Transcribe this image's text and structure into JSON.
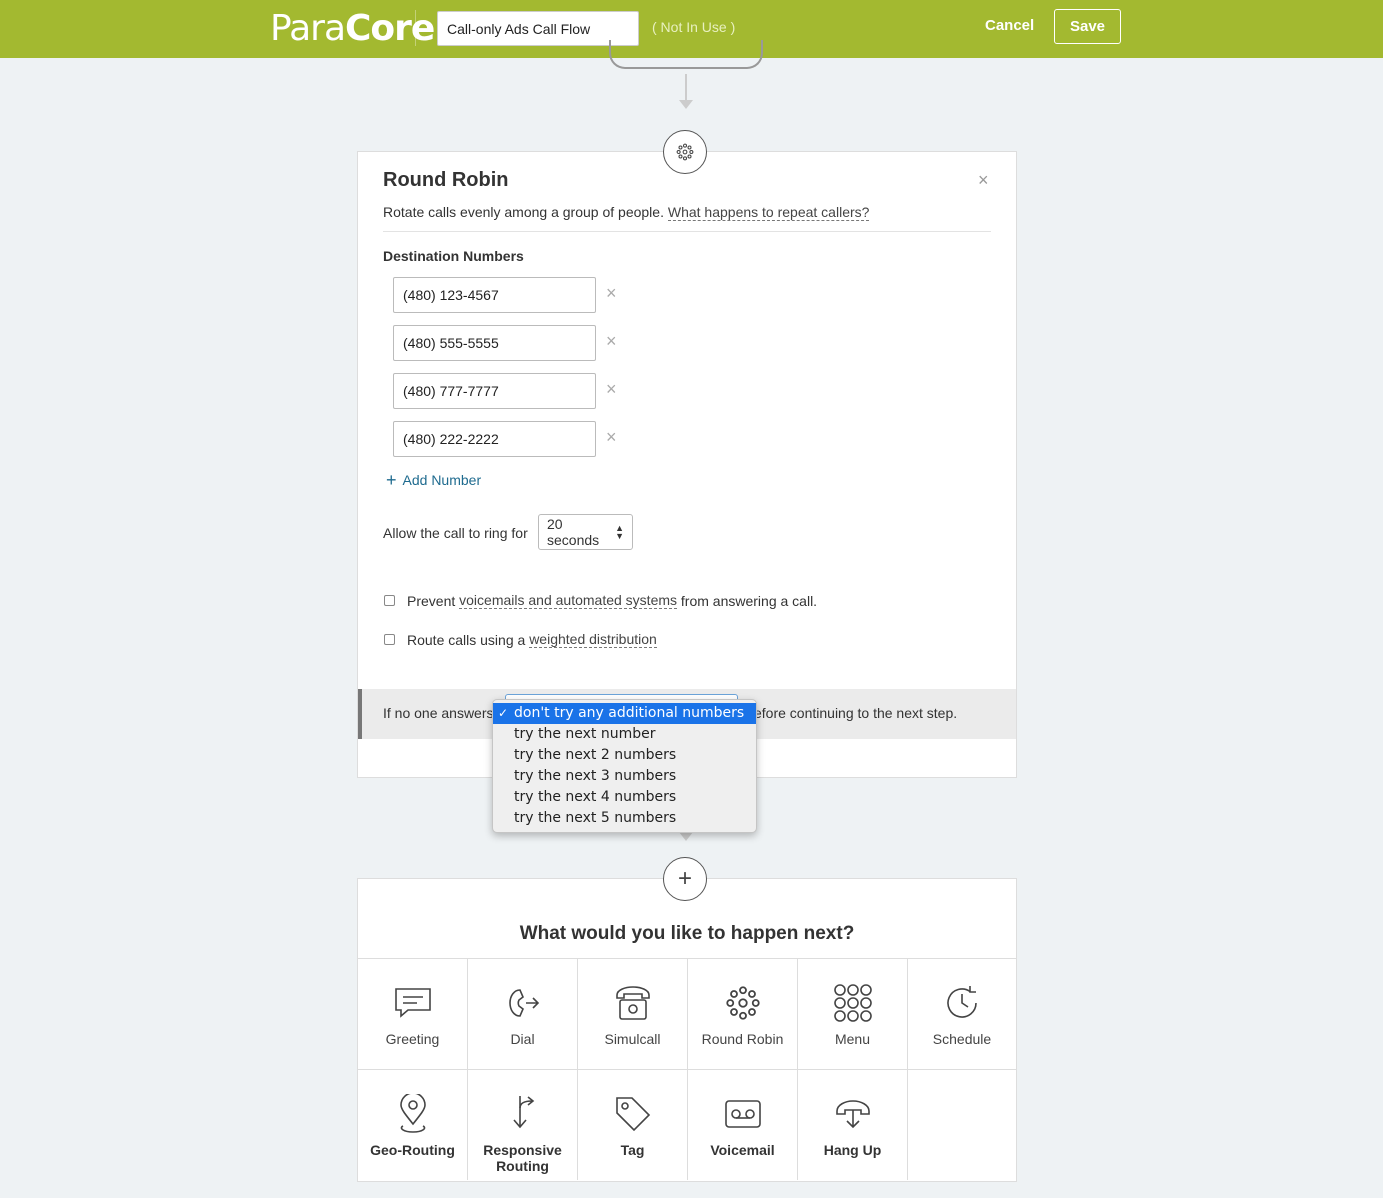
{
  "header": {
    "logo_light": "Para",
    "logo_bold": "Core",
    "flow_name": "Call-only Ads Call Flow",
    "status": "( Not In Use )",
    "cancel_label": "Cancel",
    "save_label": "Save",
    "brand_color": "#a3b930"
  },
  "round_robin": {
    "title": "Round Robin",
    "close_glyph": "×",
    "description": "Rotate calls evenly among a group of people.",
    "description_link": "What happens to repeat callers?",
    "destination_label": "Destination Numbers",
    "numbers": [
      {
        "value": "(480) 123-4567",
        "remove_glyph": "×"
      },
      {
        "value": "(480) 555-5555",
        "remove_glyph": "×"
      },
      {
        "value": "(480) 777-7777",
        "remove_glyph": "×"
      },
      {
        "value": "(480) 222-2222",
        "remove_glyph": "×"
      }
    ],
    "add_number_label": "Add Number",
    "add_glyph": "+",
    "ring_label": "Allow the call to ring for",
    "ring_value": "20 seconds",
    "prevent_pre": "Prevent",
    "prevent_link": "voicemails and automated systems",
    "prevent_post": "from answering a call.",
    "route_pre": "Route calls using a",
    "route_link": "weighted distribution",
    "no_answer_pre": "If no one answers",
    "no_answer_post": "efore continuing to the next step."
  },
  "dropdown": {
    "options": [
      "don't try any additional numbers",
      "try the next number",
      "try the next 2 numbers",
      "try the next 3 numbers",
      "try the next 4 numbers",
      "try the next 5 numbers"
    ],
    "selected_index": 0,
    "check_glyph": "✓",
    "highlight_color": "#1a73e8"
  },
  "next_step": {
    "add_glyph": "+",
    "title": "What would you like to happen next?",
    "options": [
      {
        "label": "Greeting",
        "icon": "greeting-icon"
      },
      {
        "label": "Dial",
        "icon": "dial-icon"
      },
      {
        "label": "Simulcall",
        "icon": "simulcall-icon"
      },
      {
        "label": "Round Robin",
        "icon": "round-robin-icon"
      },
      {
        "label": "Menu",
        "icon": "menu-icon"
      },
      {
        "label": "Schedule",
        "icon": "schedule-icon"
      },
      {
        "label": "Geo-Routing",
        "icon": "geo-routing-icon"
      },
      {
        "label": "Responsive Routing",
        "icon": "responsive-routing-icon"
      },
      {
        "label": "Tag",
        "icon": "tag-icon"
      },
      {
        "label": "Voicemail",
        "icon": "voicemail-icon"
      },
      {
        "label": "Hang Up",
        "icon": "hang-up-icon"
      }
    ]
  }
}
